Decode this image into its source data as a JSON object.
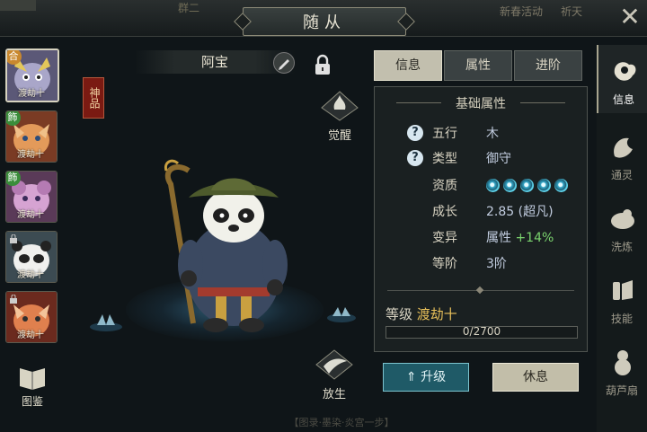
{
  "header": {
    "title": "随从",
    "tab_left": "群二",
    "right_text_1": "新春活动",
    "right_text_2": "祈天"
  },
  "character": {
    "name": "阿宝",
    "quality": "神品",
    "awaken_label": "觉醒",
    "release_label": "放生"
  },
  "roster": [
    {
      "label": "渡劫十",
      "badge": "合",
      "badge_color": "#c9882e",
      "face": "#a9a6c9",
      "selected": true
    },
    {
      "label": "渡劫十",
      "badge": "飾",
      "badge_color": "#3a8d3a",
      "face": "#d88a4a",
      "selected": false
    },
    {
      "label": "渡劫十",
      "badge": "飾",
      "badge_color": "#3a8d3a",
      "face": "#c98fc7",
      "selected": false
    },
    {
      "label": "渡劫十",
      "badge": "",
      "badge_color": "",
      "face": "#e8e8e8",
      "selected": false,
      "locked": true
    },
    {
      "label": "渡劫十",
      "badge": "",
      "badge_color": "",
      "face": "#d9774a",
      "selected": false,
      "locked": true
    }
  ],
  "codex_label": "图鉴",
  "tabs": [
    {
      "label": "信息",
      "active": true
    },
    {
      "label": "属性",
      "active": false
    },
    {
      "label": "进阶",
      "active": false
    }
  ],
  "info": {
    "section_title": "基础属性",
    "element_label": "五行",
    "element_value": "木",
    "type_label": "类型",
    "type_value": "御守",
    "aptitude_label": "资质",
    "aptitude_swirls": 5,
    "growth_label": "成长",
    "growth_value": "2.85 (超凡)",
    "mutation_label": "变异",
    "mutation_value": "属性",
    "mutation_bonus": "+14%",
    "rank_label": "等阶",
    "rank_value": "3阶",
    "level_label": "等级",
    "level_value": "渡劫十",
    "xp_text": "0/2700",
    "xp_fraction": 0
  },
  "buttons": {
    "upgrade": "升级",
    "rest": "休息"
  },
  "rightnav": [
    {
      "label": "信息",
      "icon": "info-icon",
      "active": true
    },
    {
      "label": "通灵",
      "icon": "spirit-icon",
      "active": false
    },
    {
      "label": "洗炼",
      "icon": "refine-icon",
      "active": false
    },
    {
      "label": "技能",
      "icon": "skill-icon",
      "active": false
    },
    {
      "label": "葫芦扇",
      "icon": "gourd-icon",
      "active": false
    }
  ],
  "footer_text": "【图录·墨染·炎宫一步】"
}
